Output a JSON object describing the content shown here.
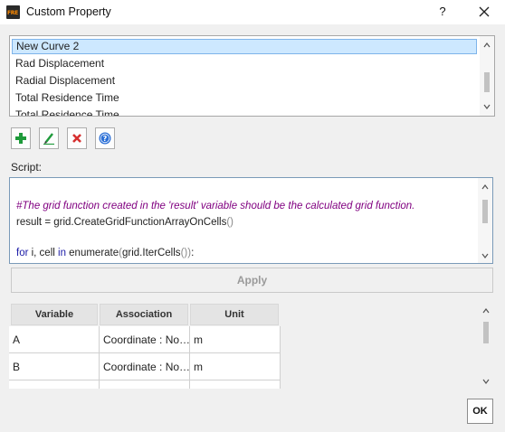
{
  "window": {
    "title": "Custom Property",
    "icon_text": "FRE",
    "help_label": "?",
    "close_icon": "close-icon"
  },
  "property_list": {
    "items": [
      {
        "label": "New Curve 2",
        "selected": true
      },
      {
        "label": "Rad Displacement",
        "selected": false
      },
      {
        "label": "Radial Displacement",
        "selected": false
      },
      {
        "label": "Total Residence Time",
        "selected": false
      },
      {
        "label": "Total Residence Time",
        "selected": false
      }
    ]
  },
  "toolbar": {
    "add_icon": "plus-icon",
    "edit_icon": "pencil-icon",
    "delete_icon": "x-icon",
    "help_icon": "help-icon"
  },
  "script": {
    "label": "Script:",
    "lines": [
      {
        "kind": "comment",
        "text": "#The grid function created in the 'result' variable should be the calculated grid function."
      },
      {
        "kind": "code",
        "text": "result = grid.CreateGridFunctionArrayOnCells()"
      },
      {
        "kind": "code",
        "text": "for i, cell in enumerate(grid.IterCells()):"
      }
    ]
  },
  "apply_label": "Apply",
  "variables_table": {
    "columns": [
      "Variable",
      "Association",
      "Unit"
    ],
    "rows": [
      {
        "variable": "A",
        "association": "Coordinate : No…",
        "unit": "m"
      },
      {
        "variable": "B",
        "association": "Coordinate : No…",
        "unit": "m"
      }
    ]
  },
  "ok_label": "OK",
  "colors": {
    "selection": "#cde8ff",
    "add_green": "#1e9a3a",
    "delete_red": "#d62f2f",
    "help_blue": "#2b6fd6",
    "comment_purple": "#800080"
  }
}
